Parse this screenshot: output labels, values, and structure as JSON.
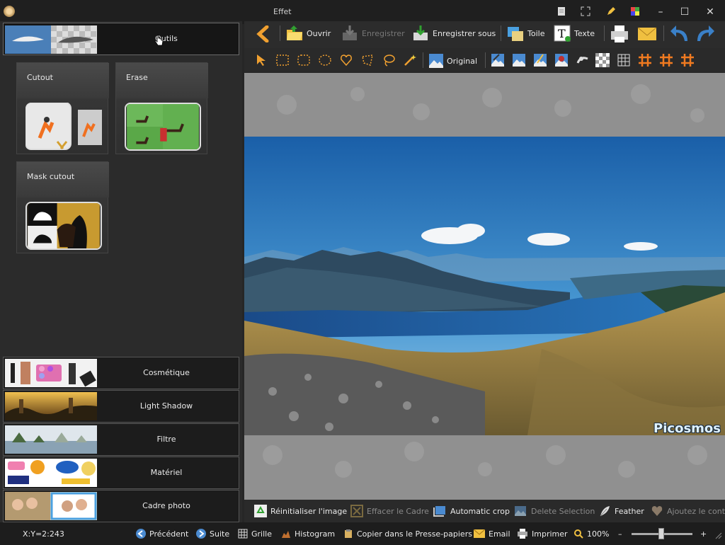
{
  "window": {
    "title": "Effet"
  },
  "left_panel": {
    "category": {
      "label": "Outils"
    },
    "tools": [
      {
        "label": "Cutout"
      },
      {
        "label": "Erase"
      },
      {
        "label": "Mask cutout"
      }
    ],
    "categories": [
      {
        "label": "Cosmétique"
      },
      {
        "label": "Light Shadow"
      },
      {
        "label": "Filtre"
      },
      {
        "label": "Matériel"
      },
      {
        "label": "Cadre photo"
      }
    ]
  },
  "toolbar": {
    "open": "Ouvrir",
    "save": "Enregistrer",
    "save_as": "Enregistrer sous",
    "canvas": "Toile",
    "text": "Texte",
    "original": "Original"
  },
  "canvas": {
    "watermark": "Picosmos"
  },
  "actions": {
    "reset": "Réinitialiser l'image",
    "clear_frame": "Effacer le Cadre",
    "auto_crop": "Automatic crop",
    "delete_selection": "Delete Selection",
    "feather": "Feather",
    "add_to": "Ajoutez le cont"
  },
  "status": {
    "coords": "X:Y=2:243",
    "previous": "Précédent",
    "next": "Suite",
    "grid": "Grille",
    "histogram": "Histogram",
    "copy": "Copier dans le Presse-papiers",
    "email": "Email",
    "print": "Imprimer",
    "zoom": "100%",
    "minus": "–",
    "plus": "+"
  },
  "colors": {
    "accent": "#f0a030",
    "bg": "#262626",
    "panel": "#2b2b2b"
  }
}
